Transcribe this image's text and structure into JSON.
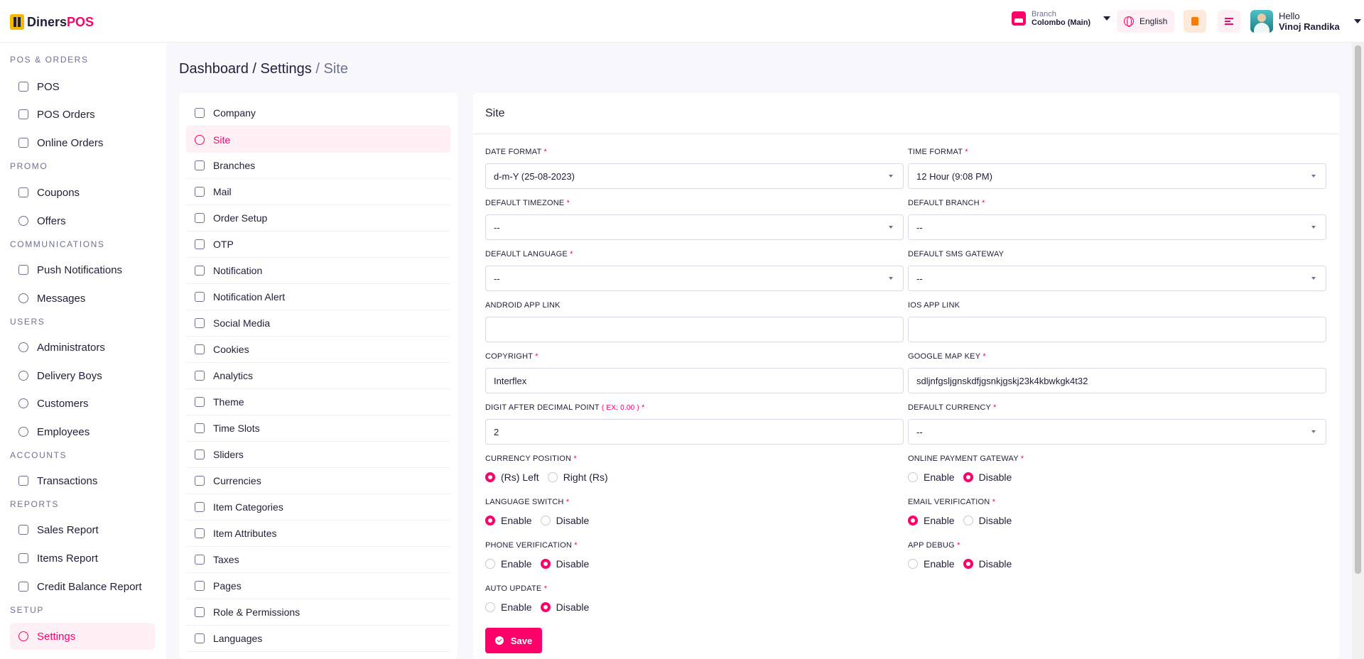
{
  "app": {
    "logo_prefix": "Diners",
    "logo_suffix": "POS"
  },
  "header": {
    "branch_label": "Branch",
    "branch_value": "Colombo (Main)",
    "language": "English",
    "greeting": "Hello",
    "user_name": "Vinoj Randika"
  },
  "sidebar": {
    "sections": {
      "pos": "POS & ORDERS",
      "promo": "PROMO",
      "communications": "COMMUNICATIONS",
      "users": "USERS",
      "accounts": "ACCOUNTS",
      "reports": "REPORTS",
      "setup": "SETUP"
    },
    "items": {
      "pos": "POS",
      "pos_orders": "POS Orders",
      "online_orders": "Online Orders",
      "coupons": "Coupons",
      "offers": "Offers",
      "push_notifications": "Push Notifications",
      "messages": "Messages",
      "administrators": "Administrators",
      "delivery_boys": "Delivery Boys",
      "customers": "Customers",
      "employees": "Employees",
      "transactions": "Transactions",
      "sales_report": "Sales Report",
      "items_report": "Items Report",
      "credit_balance_report": "Credit Balance Report",
      "settings": "Settings"
    }
  },
  "breadcrumb": {
    "dashboard": "Dashboard",
    "settings": "Settings",
    "current": "Site",
    "sep1": "/",
    "sep2": "/"
  },
  "settings_menu": [
    "Company",
    "Site",
    "Branches",
    "Mail",
    "Order Setup",
    "OTP",
    "Notification",
    "Notification Alert",
    "Social Media",
    "Cookies",
    "Analytics",
    "Theme",
    "Time Slots",
    "Sliders",
    "Currencies",
    "Item Categories",
    "Item Attributes",
    "Taxes",
    "Pages",
    "Role & Permissions",
    "Languages"
  ],
  "form": {
    "title": "Site",
    "required_mark": "*",
    "date_format": {
      "label": "DATE FORMAT",
      "value": "d-m-Y (25-08-2023)"
    },
    "time_format": {
      "label": "TIME FORMAT",
      "value": "12 Hour (9:08 PM)"
    },
    "default_timezone": {
      "label": "DEFAULT TIMEZONE",
      "value": "--"
    },
    "default_branch": {
      "label": "DEFAULT BRANCH",
      "value": "--"
    },
    "default_language": {
      "label": "DEFAULT LANGUAGE",
      "value": "--"
    },
    "default_sms_gateway": {
      "label": "DEFAULT SMS GATEWAY",
      "value": "--"
    },
    "android_app_link": {
      "label": "ANDROID APP LINK",
      "value": ""
    },
    "ios_app_link": {
      "label": "IOS APP LINK",
      "value": ""
    },
    "copyright": {
      "label": "COPYRIGHT",
      "value": "Interflex"
    },
    "google_map_key": {
      "label": "GOOGLE MAP KEY",
      "value": "sdljnfgsljgnskdfjgsnkjgskj23k4kbwkgk4t32"
    },
    "digit_after_decimal": {
      "label": "DIGIT AFTER DECIMAL POINT",
      "hint": "( EX: 0.00 )",
      "value": "2"
    },
    "default_currency": {
      "label": "DEFAULT CURRENCY",
      "value": "--"
    },
    "currency_position": {
      "label": "CURRENCY POSITION",
      "opt1": "(Rs) Left",
      "opt2": "Right (Rs)",
      "selected": 1
    },
    "online_payment_gateway": {
      "label": "ONLINE PAYMENT GATEWAY",
      "opt1": "Enable",
      "opt2": "Disable",
      "selected": 2
    },
    "language_switch": {
      "label": "LANGUAGE SWITCH",
      "opt1": "Enable",
      "opt2": "Disable",
      "selected": 1
    },
    "email_verification": {
      "label": "EMAIL VERIFICATION",
      "opt1": "Enable",
      "opt2": "Disable",
      "selected": 1
    },
    "phone_verification": {
      "label": "PHONE VERIFICATION",
      "opt1": "Enable",
      "opt2": "Disable",
      "selected": 2
    },
    "app_debug": {
      "label": "APP DEBUG",
      "opt1": "Enable",
      "opt2": "Disable",
      "selected": 2
    },
    "auto_update": {
      "label": "AUTO UPDATE",
      "opt1": "Enable",
      "opt2": "Disable",
      "selected": 2
    },
    "save_label": "Save"
  },
  "colors": {
    "accent": "#ff006b",
    "background": "#f7f7fc",
    "text": "#1f1f39"
  }
}
